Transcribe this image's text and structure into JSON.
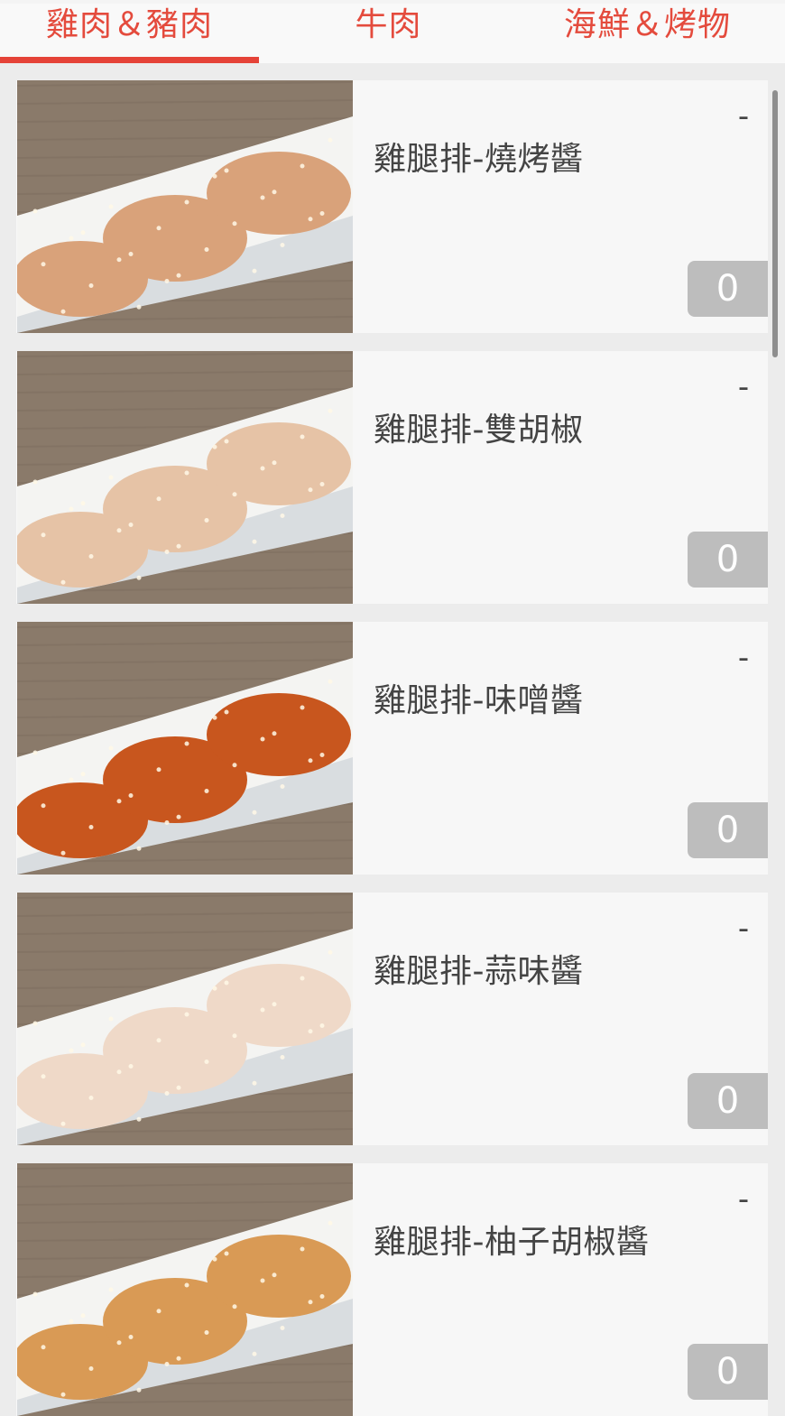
{
  "tabs": [
    {
      "label": "雞肉＆豬肉",
      "active": true
    },
    {
      "label": "牛肉",
      "active": false
    },
    {
      "label": "海鮮＆烤物",
      "active": false
    }
  ],
  "accent_color": "#e54338",
  "items": [
    {
      "name": "雞腿排-燒烤醬",
      "minus": "-",
      "qty": "0",
      "sauce_color": "#d9a27a"
    },
    {
      "name": "雞腿排-雙胡椒",
      "minus": "-",
      "qty": "0",
      "sauce_color": "#e6c3a6"
    },
    {
      "name": "雞腿排-味噌醬",
      "minus": "-",
      "qty": "0",
      "sauce_color": "#c8561e"
    },
    {
      "name": "雞腿排-蒜味醬",
      "minus": "-",
      "qty": "0",
      "sauce_color": "#efd9c8"
    },
    {
      "name": "雞腿排-柚子胡椒醬",
      "minus": "-",
      "qty": "0",
      "sauce_color": "#d99a55"
    }
  ]
}
